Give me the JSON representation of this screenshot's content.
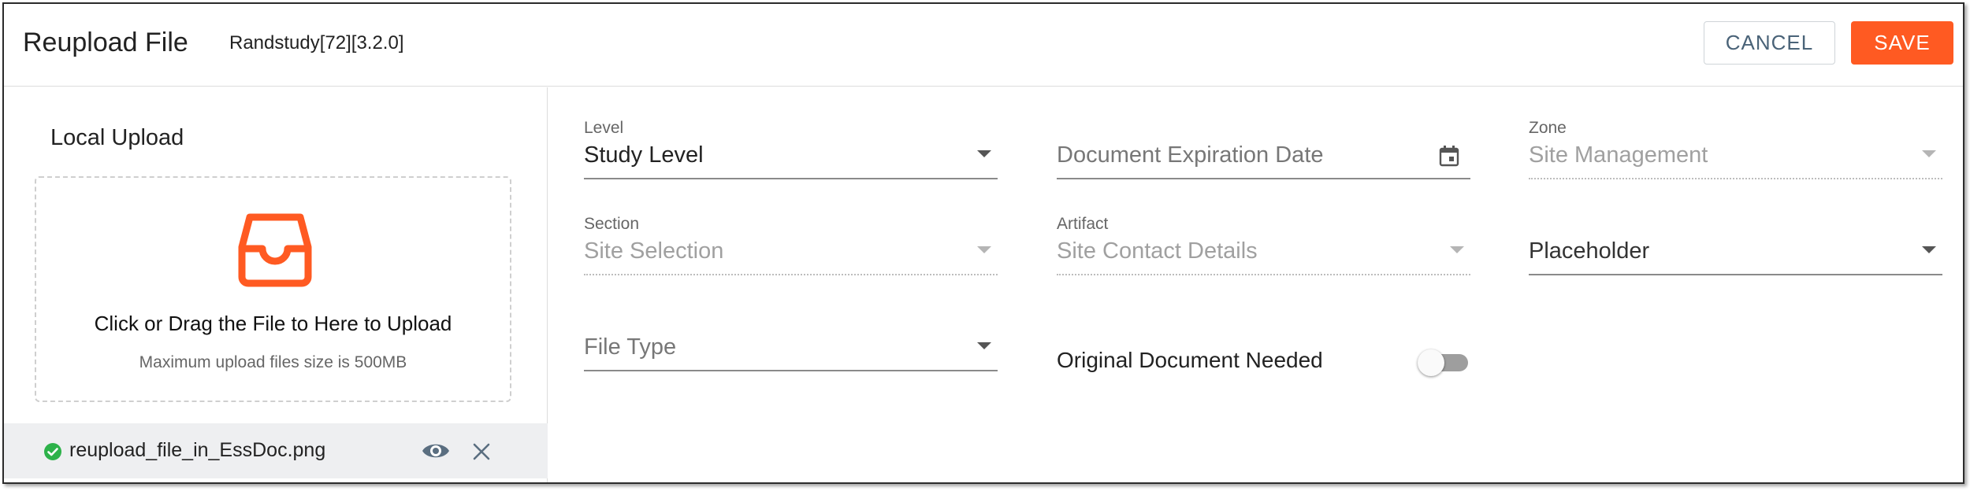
{
  "header": {
    "title": "Reupload File",
    "subtitle": "Randstudy[72][3.2.0]",
    "cancel_label": "CANCEL",
    "save_label": "SAVE"
  },
  "upload": {
    "title": "Local Upload",
    "drop_text": "Click or Drag the File to Here to Upload",
    "max_size_text": "Maximum upload files size is 500MB",
    "icon": "inbox-icon",
    "file": {
      "name": "reupload_file_in_EssDoc.png",
      "status_icon": "check-circle-icon",
      "status_color": "#2db24a"
    }
  },
  "form": {
    "level": {
      "label": "Level",
      "value": "Study Level"
    },
    "expiration": {
      "placeholder": "Document Expiration Date"
    },
    "zone": {
      "label": "Zone",
      "value": "Site Management"
    },
    "section": {
      "label": "Section",
      "value": "Site Selection"
    },
    "artifact": {
      "label": "Artifact",
      "value": "Site Contact Details"
    },
    "placeholder_field": {
      "value": "Placeholder"
    },
    "file_type": {
      "placeholder": "File Type"
    },
    "original_needed": {
      "label": "Original Document Needed",
      "checked": false
    }
  },
  "colors": {
    "accent": "#ff5a22",
    "cancel_text": "#4a6378",
    "success": "#2db24a"
  }
}
